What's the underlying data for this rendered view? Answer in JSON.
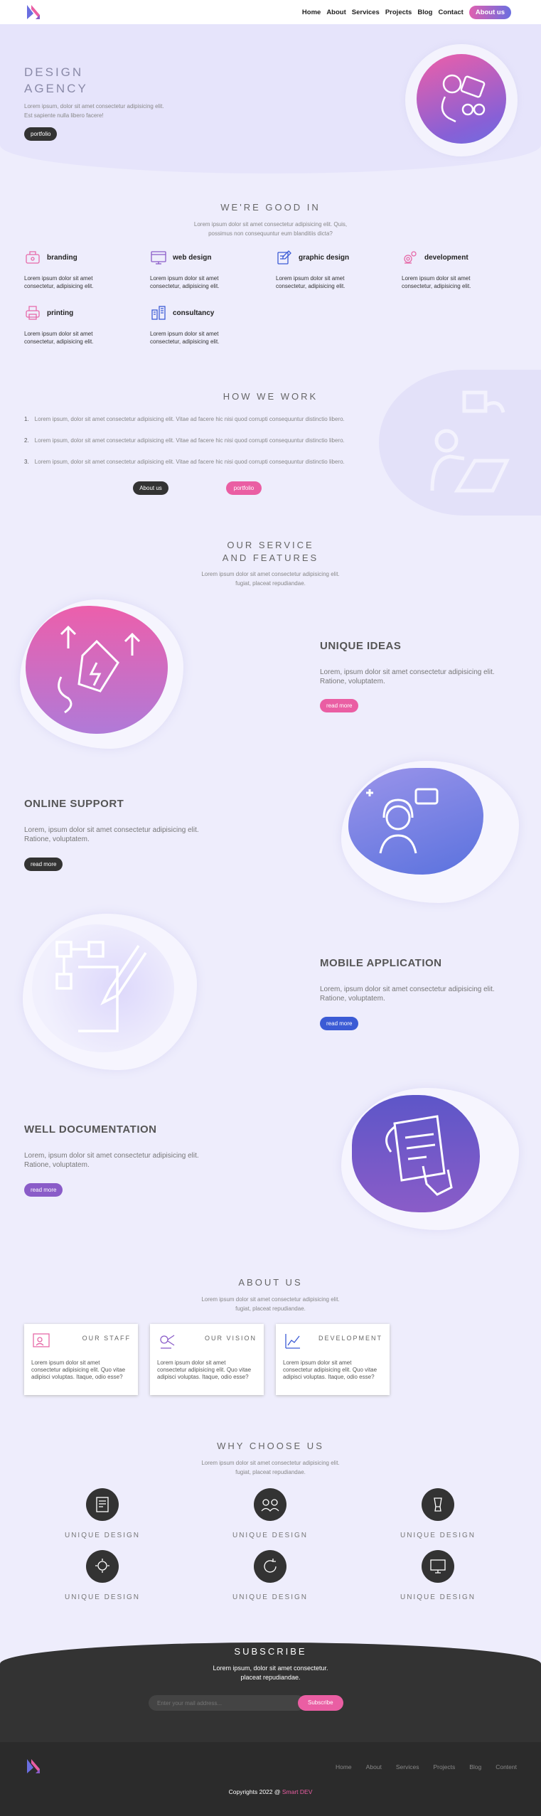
{
  "nav": {
    "links": [
      "Home",
      "About",
      "Services",
      "Projects",
      "Blog",
      "Contact"
    ],
    "cta": "About us"
  },
  "hero": {
    "title_line1": "DESIGN",
    "title_line2": "AGENCY",
    "text_line1": "Lorem ipsum, dolor sit amet consectetur adipisicing elit.",
    "text_line2": "Est sapiente nulla libero facere!",
    "button": "portfolio"
  },
  "good": {
    "title": "WE'RE GOOD IN",
    "sub_line1": "Lorem ipsum dolor sit amet consectetur adipisicing elit. Quis,",
    "sub_line2": "possimus non consequuntur eum blanditiis dicta?",
    "items": [
      {
        "title": "branding",
        "desc": "Lorem ipsum dolor sit amet consectetur, adipisicing elit."
      },
      {
        "title": "web design",
        "desc": "Lorem ipsum dolor sit amet consectetur, adipisicing elit."
      },
      {
        "title": "graphic design",
        "desc": "Lorem ipsum dolor sit amet consectetur, adipisicing elit."
      },
      {
        "title": "development",
        "desc": "Lorem ipsum dolor sit amet consectetur, adipisicing elit."
      },
      {
        "title": "printing",
        "desc": "Lorem ipsum dolor sit amet consectetur, adipisicing elit."
      },
      {
        "title": "consultancy",
        "desc": "Lorem ipsum dolor sit amet consectetur, adipisicing elit."
      }
    ]
  },
  "how": {
    "title": "HOW WE WORK",
    "steps": [
      "Lorem ipsum, dolor sit amet consectetur adipisicing elit. Vitae ad facere hic nisi quod corrupti consequuntur distinctio libero.",
      "Lorem ipsum, dolor sit amet consectetur adipisicing elit. Vitae ad facere hic nisi quod corrupti consequuntur distinctio libero.",
      "Lorem ipsum, dolor sit amet consectetur adipisicing elit. Vitae ad facere hic nisi quod corrupti consequuntur distinctio libero."
    ],
    "btn_about": "About us",
    "btn_portfolio": "portfolio"
  },
  "features": {
    "title_line1": "OUR SERVICE",
    "title_line2": "AND FEATURES",
    "sub_line1": "Lorem ipsum dolor sit amet consectetur adipisicing elit.",
    "sub_line2": "fugiat, placeat repudiandae.",
    "items": [
      {
        "title": "UNIQUE IDEAS",
        "text": "Lorem, ipsum dolor sit amet consectetur adipisicing elit. Ratione, voluptatem.",
        "button": "read more"
      },
      {
        "title": "ONLINE SUPPORT",
        "text": "Lorem, ipsum dolor sit amet consectetur adipisicing elit. Ratione, voluptatem.",
        "button": "read more"
      },
      {
        "title": "MOBILE APPLICATION",
        "text": "Lorem, ipsum dolor sit amet consectetur adipisicing elit. Ratione, voluptatem.",
        "button": "read more"
      },
      {
        "title": "WELL DOCUMENTATION",
        "text": "Lorem, ipsum dolor sit amet consectetur adipisicing elit. Ratione, voluptatem.",
        "button": "read more"
      }
    ]
  },
  "about": {
    "title": "ABOUT US",
    "sub_line1": "Lorem ipsum dolor sit amet consectetur adipisicing elit.",
    "sub_line2": "fugiat, placeat repudiandae.",
    "cards": [
      {
        "title": "OUR STAFF",
        "text": "Lorem ipsum dolor sit amet consectetur adipisicing elit. Quo vitae adipisci voluptas. Itaque, odio esse?"
      },
      {
        "title": "OUR VISION",
        "text": "Lorem ipsum dolor sit amet consectetur adipisicing elit. Quo vitae adipisci voluptas. Itaque, odio esse?"
      },
      {
        "title": "DEVELOPMENT",
        "text": "Lorem ipsum dolor sit amet consectetur adipisicing elit. Quo vitae adipisci voluptas. Itaque, odio esse?"
      }
    ]
  },
  "why": {
    "title": "WHY CHOOSE US",
    "sub_line1": "Lorem ipsum dolor sit amet consectetur adipisicing elit.",
    "sub_line2": "fugiat, placeat repudiandae.",
    "items": [
      "UNIQUE DESIGN",
      "UNIQUE DESIGN",
      "UNIQUE DESIGN",
      "UNIQUE DESIGN",
      "UNIQUE DESIGN",
      "UNIQUE DESIGN"
    ]
  },
  "subscribe": {
    "title": "SUBSCRIBE",
    "sub_line1": "Lorem ipsum, dolor sit amet consectetur.",
    "sub_line2": "placeat repudiandae.",
    "placeholder": "Enter your mail address...",
    "button": "Subscribe"
  },
  "footer": {
    "links": [
      "Home",
      "About",
      "Services",
      "Projects",
      "Blog",
      "Content"
    ],
    "copyright": "Copyrights 2022 @ ",
    "brand": "Smart DEV"
  },
  "colors": {
    "pink": "#ea5ea3",
    "blue": "#3b5bd5",
    "purple": "#8a5cc8",
    "dark": "#333333"
  }
}
